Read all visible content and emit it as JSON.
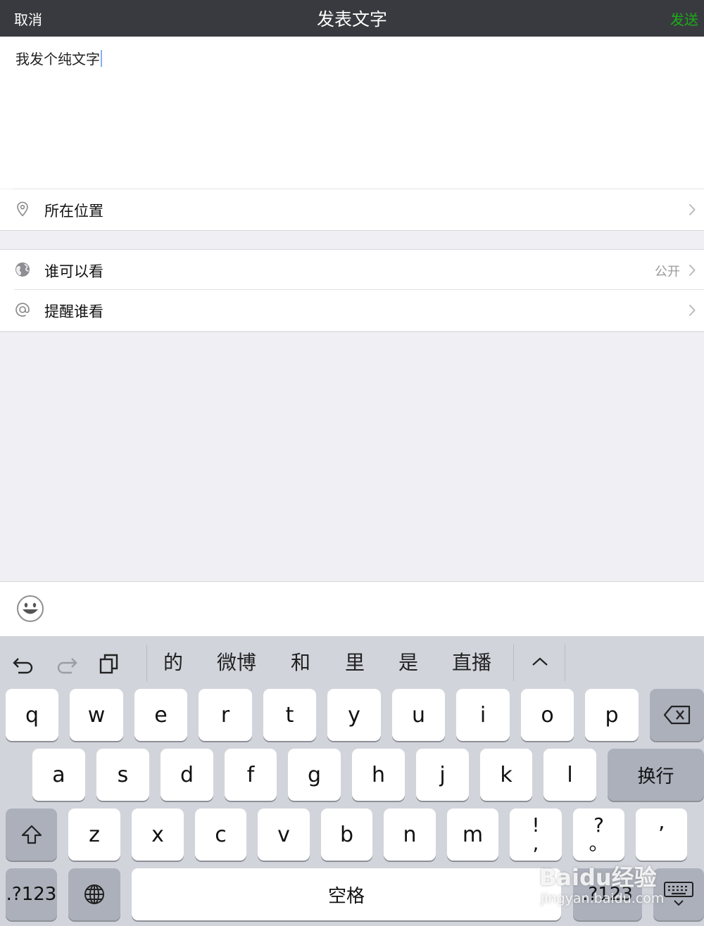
{
  "navbar": {
    "cancel": "取消",
    "title": "发表文字",
    "send": "发送"
  },
  "compose": {
    "text": "我发个纯文字"
  },
  "location": {
    "label": "所在位置",
    "icon": "location-pin-icon"
  },
  "visibility": {
    "label": "谁可以看",
    "value": "公开",
    "icon": "globe-icon"
  },
  "mention": {
    "label": "提醒谁看",
    "icon": "at-icon"
  },
  "emoji_bar": {
    "icon": "smiley-icon"
  },
  "keyboard": {
    "toolbar_icons": [
      "undo-icon",
      "redo-icon",
      "clipboard-icon",
      "chevron-up-icon"
    ],
    "candidates": [
      "的",
      "微博",
      "和",
      "里",
      "是",
      "直播"
    ],
    "row1": [
      "q",
      "w",
      "e",
      "r",
      "t",
      "y",
      "u",
      "i",
      "o",
      "p"
    ],
    "row2": [
      "a",
      "s",
      "d",
      "f",
      "g",
      "h",
      "j",
      "k",
      "l"
    ],
    "return_label": "换行",
    "row3": [
      "z",
      "x",
      "c",
      "v",
      "b",
      "n",
      "m"
    ],
    "punct1_top": "!",
    "punct1_bottom": ",",
    "punct2_top": "?",
    "punct2_bottom": "。",
    "punct3": "’",
    "numbers_label": ".?123",
    "space_label": "空格",
    "numbers_label_right": ".?123"
  },
  "watermark": {
    "brand": "Baidu经验",
    "url": "jingyan.baidu.com"
  },
  "colors": {
    "navbar_bg": "#393a3f",
    "send_green": "#1aad19",
    "page_bg": "#efeff4",
    "keyboard_bg": "#d1d4db"
  }
}
